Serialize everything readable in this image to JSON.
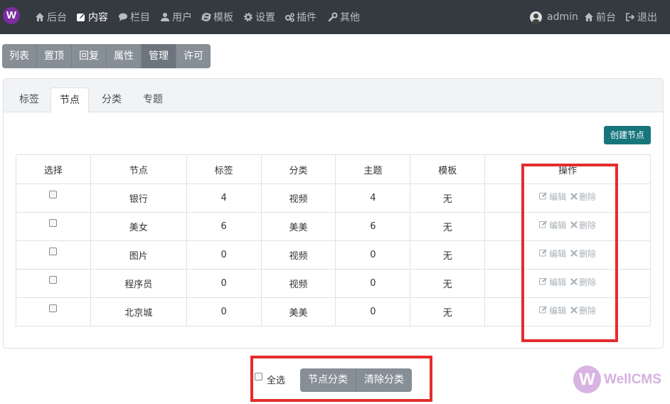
{
  "brand": {
    "logo_letter": "W"
  },
  "topnav": {
    "items": [
      {
        "label": "后台",
        "icon": "home-icon"
      },
      {
        "label": "内容",
        "icon": "edit-icon",
        "active": true
      },
      {
        "label": "栏目",
        "icon": "comment-icon"
      },
      {
        "label": "用户",
        "icon": "user-icon"
      },
      {
        "label": "模板",
        "icon": "ie-icon"
      },
      {
        "label": "设置",
        "icon": "gear-icon"
      },
      {
        "label": "插件",
        "icon": "gears-icon"
      },
      {
        "label": "其他",
        "icon": "wrench-icon"
      }
    ],
    "right": [
      {
        "label": "admin",
        "icon": "avatar-icon"
      },
      {
        "label": "前台",
        "icon": "home-icon"
      },
      {
        "label": "退出",
        "icon": "sign-out-icon"
      }
    ]
  },
  "subtabs": [
    "列表",
    "置顶",
    "回复",
    "属性",
    "管理",
    "许可"
  ],
  "subtab_active": "管理",
  "card_tabs": [
    "标签",
    "节点",
    "分类",
    "专题"
  ],
  "card_tab_active": "节点",
  "create_button": "创建节点",
  "table": {
    "headers": [
      "选择",
      "节点",
      "标签",
      "分类",
      "主题",
      "模板",
      "操作"
    ],
    "rows": [
      {
        "node": "银行",
        "tag": "4",
        "category": "视频",
        "topic": "4",
        "template": "无"
      },
      {
        "node": "美女",
        "tag": "6",
        "category": "美美",
        "topic": "6",
        "template": "无"
      },
      {
        "node": "图片",
        "tag": "0",
        "category": "视频",
        "topic": "0",
        "template": "无"
      },
      {
        "node": "程序员",
        "tag": "0",
        "category": "视频",
        "topic": "0",
        "template": "无"
      },
      {
        "node": "北京城",
        "tag": "0",
        "category": "美美",
        "topic": "0",
        "template": "无"
      }
    ],
    "edit_label": "编辑",
    "delete_label": "删除"
  },
  "bottom": {
    "select_all": "全选",
    "buttons": [
      "节点分类",
      "清除分类"
    ]
  },
  "watermark": {
    "letter": "W",
    "text": "WellCMS"
  },
  "colors": {
    "nav_bg": "#343a40",
    "accent": "#17767b",
    "highlight": "#e52d2d",
    "brand": "#7b2d9e"
  }
}
